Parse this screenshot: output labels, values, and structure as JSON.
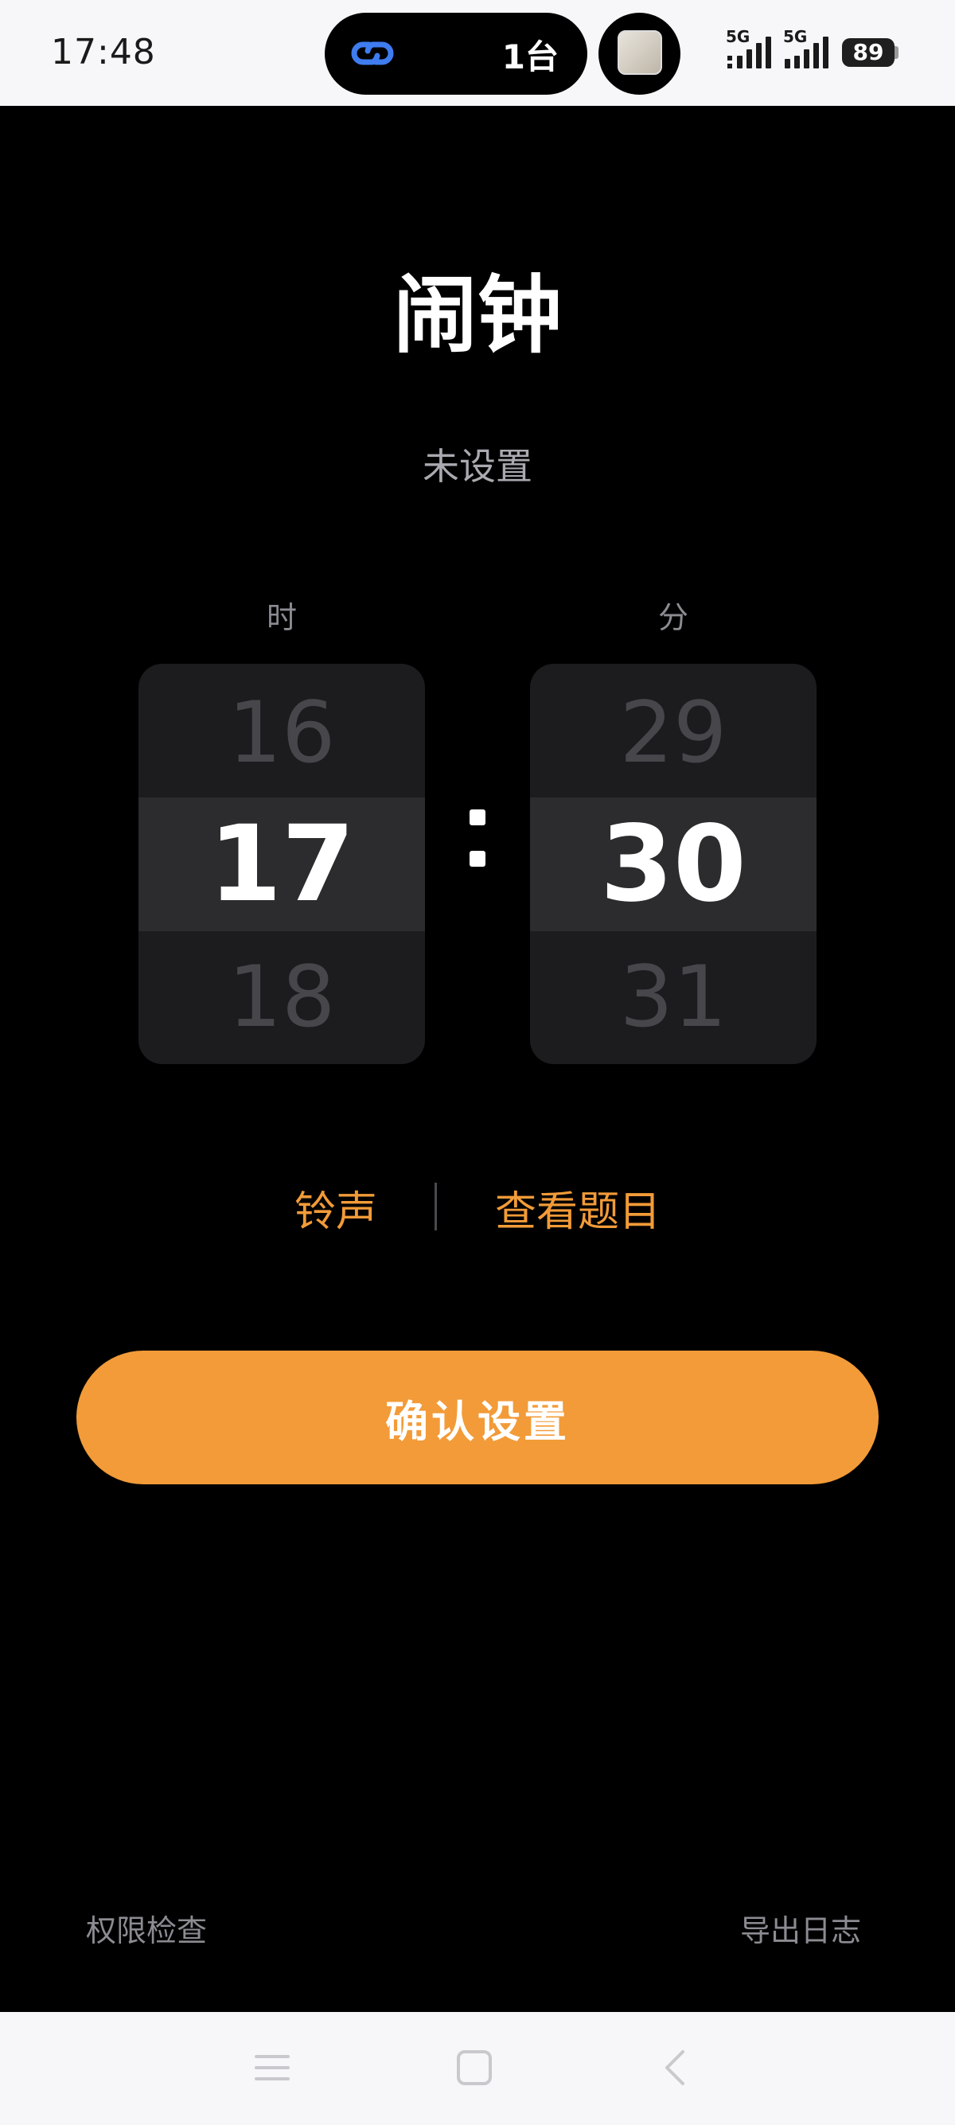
{
  "status_bar": {
    "time": "17:48",
    "island_count": "1台",
    "signal_1_label": "5G",
    "signal_2_label": "5G",
    "battery": "89",
    "link_icon": "link-icon",
    "link_color": "#3f7cf0"
  },
  "page": {
    "title": "闹钟",
    "status": "未设置"
  },
  "picker": {
    "hour_label": "时",
    "minute_label": "分",
    "hours": {
      "prev": "16",
      "selected": "17",
      "next": "18"
    },
    "minutes": {
      "prev": "29",
      "selected": "30",
      "next": "31"
    }
  },
  "links": {
    "ringtone": "铃声",
    "view_questions": "查看题目"
  },
  "confirm_label": "确认设置",
  "footer": {
    "permissions": "权限检查",
    "export_log": "导出日志"
  },
  "colors": {
    "accent": "#f29b38",
    "background": "#000000",
    "picker_bg": "#1c1c1e"
  },
  "nav_icons": [
    "menu-icon",
    "home-icon",
    "back-icon"
  ]
}
